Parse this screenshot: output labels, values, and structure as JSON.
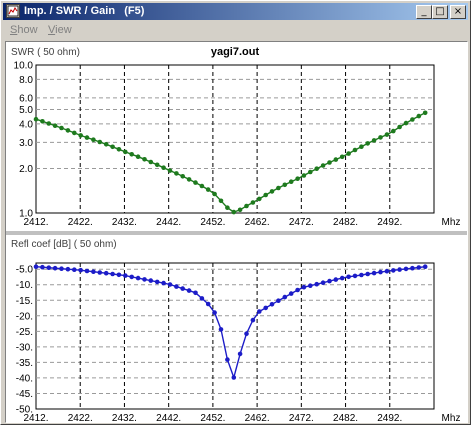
{
  "window": {
    "title": "Imp. / SWR / Gain   (F5)",
    "icon": "chart-icon",
    "controls": {
      "minimize": "_",
      "maximize": "□",
      "close": "×"
    }
  },
  "menu": {
    "items": [
      {
        "label": "Show",
        "mnemonic": "S",
        "rest": "how"
      },
      {
        "label": "View",
        "mnemonic": "V",
        "rest": "iew"
      }
    ]
  },
  "chart_data": [
    {
      "type": "line",
      "title": "yagi7.out",
      "ylabel": "SWR ( 50 ohm)",
      "xlabel": "Mhz",
      "yscale": "log",
      "ylim": [
        1.0,
        10.0
      ],
      "xlim": [
        2412,
        2502
      ],
      "x_ticks": [
        "2412.",
        "2422.",
        "2432.",
        "2442.",
        "2452.",
        "2462.",
        "2472.",
        "2482.",
        "2492."
      ],
      "y_ticks": [
        "10.0",
        "8.0",
        "6.0",
        "5.0",
        "4.0",
        "3.0",
        "2.0",
        "1.0"
      ],
      "grid": true,
      "color": "#1e7a1e",
      "series": [
        {
          "x": [
            2412,
            2422,
            2432,
            2442,
            2452,
            2455,
            2457,
            2462,
            2472,
            2482,
            2492,
            2500
          ],
          "values": [
            4.3,
            3.35,
            2.6,
            1.95,
            1.38,
            1.1,
            1.0,
            1.22,
            1.75,
            2.45,
            3.45,
            4.75
          ]
        }
      ]
    },
    {
      "type": "line",
      "title": "",
      "ylabel": "Refl coef [dB] ( 50 ohm)",
      "xlabel": "Mhz",
      "ylim": [
        -50,
        -3
      ],
      "xlim": [
        2412,
        2502
      ],
      "x_ticks": [
        "2412.",
        "2422.",
        "2432.",
        "2442.",
        "2452.",
        "2462.",
        "2472.",
        "2482.",
        "2492."
      ],
      "y_ticks": [
        "-5.0",
        "-10.",
        "-15.",
        "-20.",
        "-25.",
        "-30.",
        "-35.",
        "-40.",
        "-45.",
        "-50."
      ],
      "grid": true,
      "color": "#1c1cc8",
      "series": [
        {
          "x": [
            2412,
            2422,
            2432,
            2442,
            2448,
            2452,
            2454,
            2455,
            2456,
            2457,
            2458,
            2460,
            2462,
            2472,
            2482,
            2492,
            2500
          ],
          "values": [
            -4.2,
            -5.3,
            -7.0,
            -9.8,
            -12.5,
            -17.5,
            -25,
            -32,
            -39.5,
            -40,
            -33,
            -24,
            -19,
            -11,
            -7.6,
            -5.5,
            -4.2
          ]
        }
      ]
    }
  ]
}
